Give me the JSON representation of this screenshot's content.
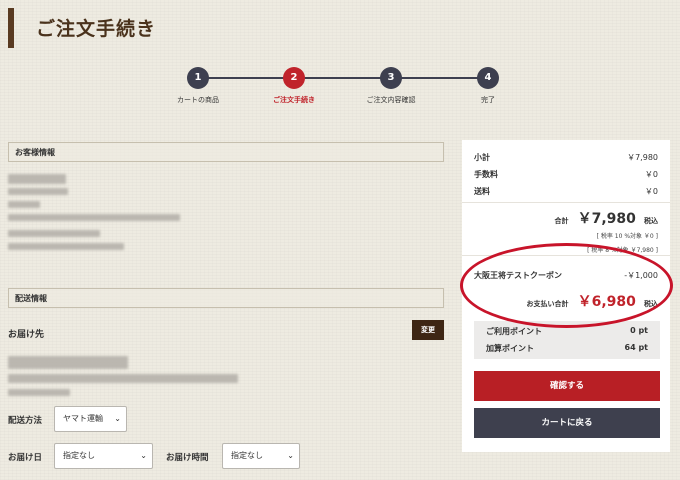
{
  "header": {
    "title": "ご注文手続き"
  },
  "steps": [
    {
      "num": "1",
      "label": "カートの商品"
    },
    {
      "num": "2",
      "label": "ご注文手続き"
    },
    {
      "num": "3",
      "label": "ご注文内容確認"
    },
    {
      "num": "4",
      "label": "完了"
    }
  ],
  "customer": {
    "heading": "お客様情報"
  },
  "shipping": {
    "heading": "配送情報",
    "destination_label": "お届け先",
    "change_label": "変更",
    "method_label": "配送方法",
    "method_value": "ヤマト運輸",
    "date_label": "お届け日",
    "date_value": "指定なし",
    "time_label": "お届け時間",
    "time_value": "指定なし"
  },
  "summary": {
    "subtotal_label": "小計",
    "subtotal_value": "￥7,980",
    "fee_label": "手数料",
    "fee_value": "￥0",
    "postage_label": "送料",
    "postage_value": "￥0",
    "total_label": "合計",
    "total_value": "￥7,980",
    "tax_suffix": "税込",
    "tax_rate_note": "[ 税率 10 %対象 ￥0 ]",
    "tax_rate_note2": "[ 税率 8 %対象 ￥7,980 ]",
    "coupon_label": "大阪王将テストクーポン",
    "coupon_value": "-￥1,000",
    "pay_label": "お支払い合計",
    "pay_value": "￥6,980",
    "pay_suffix": "税込",
    "use_points_label": "ご利用ポイント",
    "use_points_value": "0 pt",
    "add_points_label": "加算ポイント",
    "add_points_value": "64 pt",
    "confirm_label": "確認する",
    "back_label": "カートに戻る"
  },
  "colors": {
    "accent": "#c0232b",
    "brand_dark": "#3e2614",
    "step_dark": "#3d3f4f",
    "annotation": "#c8142a"
  }
}
